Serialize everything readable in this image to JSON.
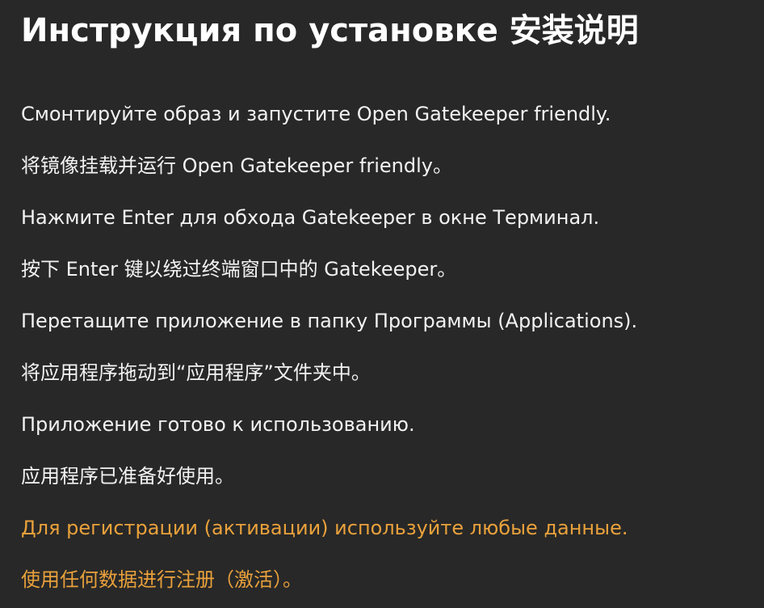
{
  "title": "Инструкция по установке  安装说明",
  "colors": {
    "background": "#282828",
    "text": "#f2f2f2",
    "title": "#ffffff",
    "accent": "#e9a13b"
  },
  "lines": [
    {
      "text": "Смонтируйте образ и запустите Open Gatekeeper friendly.",
      "accent": false
    },
    {
      "text": "将镜像挂载并运行 Open Gatekeeper friendly。",
      "accent": false
    },
    {
      "text": "Нажмите Enter для обхода Gatekeeper в окне Терминал.",
      "accent": false
    },
    {
      "text": "按下 Enter 键以绕过终端窗口中的 Gatekeeper。",
      "accent": false
    },
    {
      "text": "Перетащите приложение в папку Программы (Applications).",
      "accent": false
    },
    {
      "text": "将应用程序拖动到“应用程序”文件夹中。",
      "accent": false
    },
    {
      "text": "Приложение готово к использованию.",
      "accent": false
    },
    {
      "text": "应用程序已准备好使用。",
      "accent": false
    },
    {
      "text": "Для регистрации (активации) используйте любые данные.",
      "accent": true
    },
    {
      "text": "使用任何数据进行注册（激活）。",
      "accent": true
    }
  ]
}
